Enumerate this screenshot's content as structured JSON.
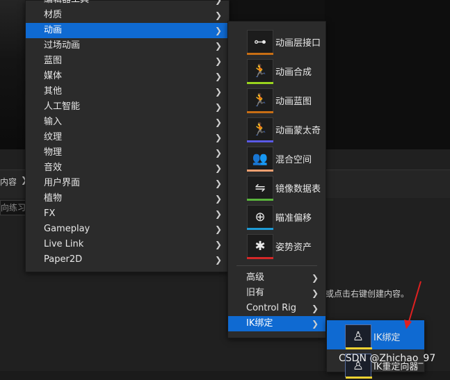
{
  "breadcrumb": {
    "text": "内容",
    "arrow": "❯"
  },
  "search": {
    "value": "向练习"
  },
  "hint": "或点击右键创建内容。",
  "main_menu": {
    "items": [
      {
        "label": "编辑器工具",
        "selected": false
      },
      {
        "label": "材质",
        "selected": false
      },
      {
        "label": "动画",
        "selected": true
      },
      {
        "label": "过场动画",
        "selected": false
      },
      {
        "label": "蓝图",
        "selected": false
      },
      {
        "label": "媒体",
        "selected": false
      },
      {
        "label": "其他",
        "selected": false
      },
      {
        "label": "人工智能",
        "selected": false
      },
      {
        "label": "输入",
        "selected": false
      },
      {
        "label": "纹理",
        "selected": false
      },
      {
        "label": "物理",
        "selected": false
      },
      {
        "label": "音效",
        "selected": false
      },
      {
        "label": "用户界面",
        "selected": false
      },
      {
        "label": "植物",
        "selected": false
      },
      {
        "label": "FX",
        "selected": false
      },
      {
        "label": "Gameplay",
        "selected": false
      },
      {
        "label": "Live Link",
        "selected": false
      },
      {
        "label": "Paper2D",
        "selected": false
      }
    ]
  },
  "animation_menu": {
    "assets": [
      {
        "label": "动画层接口",
        "icon": "node-graph-icon",
        "color": "#c86e14"
      },
      {
        "label": "动画合成",
        "icon": "running-figure-stack-icon",
        "color": "#9ad41e"
      },
      {
        "label": "动画蓝图",
        "icon": "running-figure-graph-icon",
        "color": "#c86e14"
      },
      {
        "label": "动画蒙太奇",
        "icon": "running-figure-filmstrip-icon",
        "color": "#5a5ae6"
      },
      {
        "label": "混合空间",
        "icon": "figures-blend-icon",
        "color": "#f0a070"
      },
      {
        "label": "镜像数据表",
        "icon": "mirror-figures-icon",
        "color": "#5ab43c"
      },
      {
        "label": "瞄准偏移",
        "icon": "crosshair-icon",
        "color": "#1e9ad4"
      },
      {
        "label": "姿势资产",
        "icon": "pose-figure-icon",
        "color": "#d42828"
      }
    ],
    "items": [
      {
        "label": "高级",
        "selected": false
      },
      {
        "label": "旧有",
        "selected": false
      },
      {
        "label": "Control Rig",
        "selected": false
      },
      {
        "label": "IK绑定",
        "selected": true
      }
    ]
  },
  "ik_menu": {
    "assets": [
      {
        "label": "IK绑定",
        "icon": "ik-rig-figure-icon",
        "color": "#f0d232",
        "selected": true
      },
      {
        "label": "IK重定向器",
        "icon": "ik-retarget-figure-icon",
        "color": "#f0d232",
        "selected": false
      }
    ]
  },
  "watermark": "CSDN @Zhichao_97",
  "colors": {
    "accent": "#0f6ad2",
    "menu_bg": "#2b2b2b",
    "arrow": "#e02020"
  }
}
